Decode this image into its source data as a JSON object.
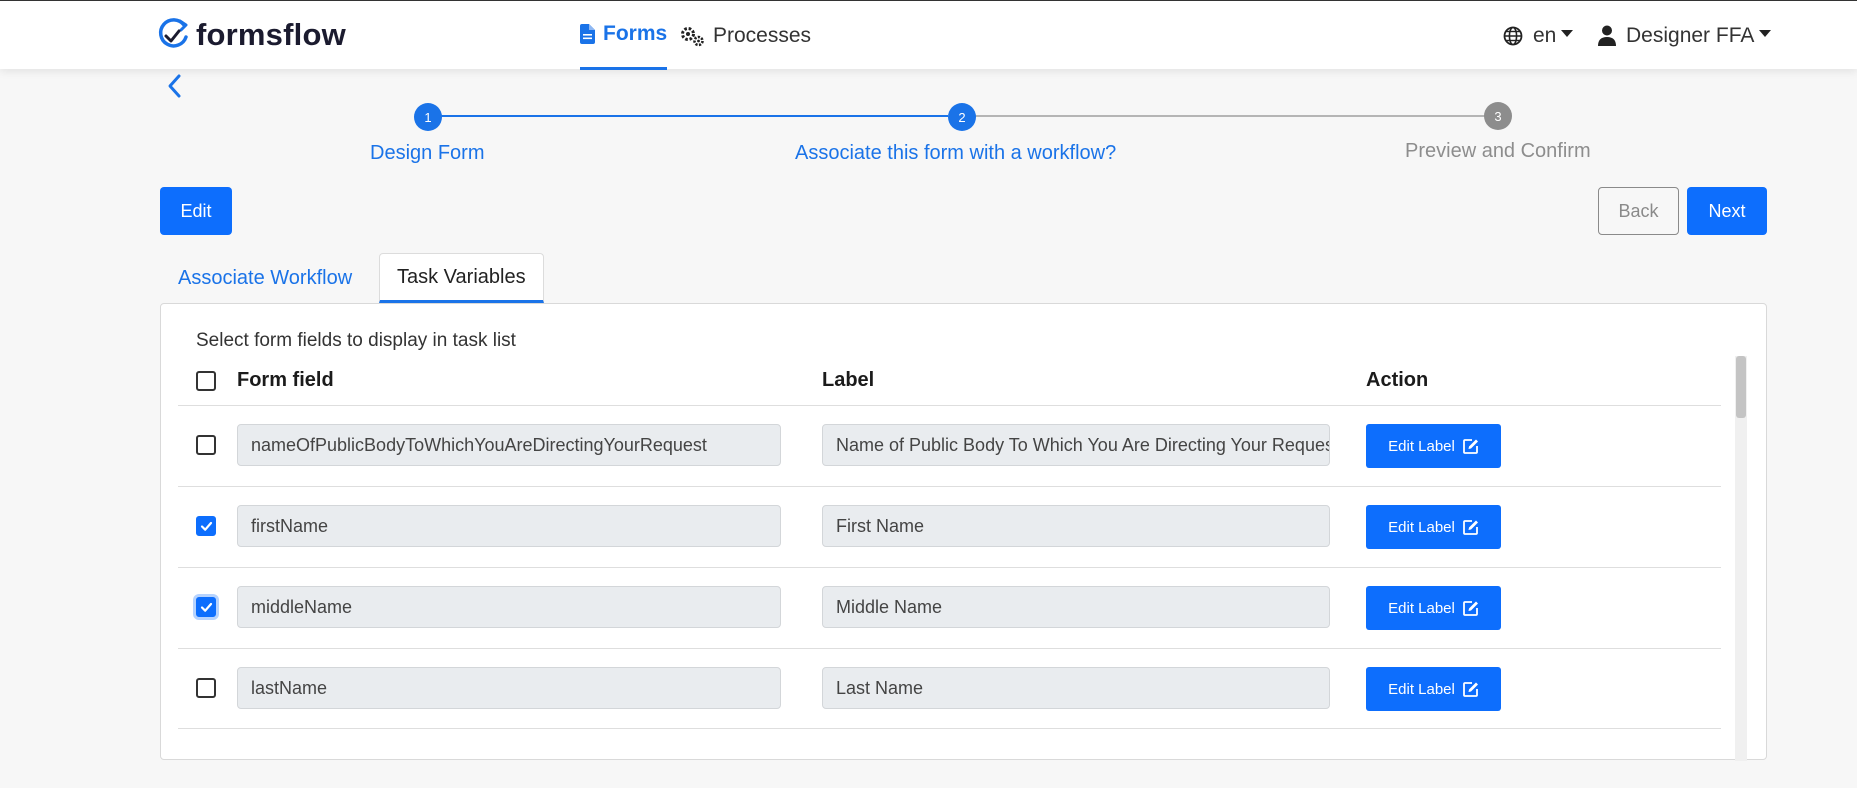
{
  "brand": {
    "name": "formsflow",
    "logo": "formsflow-refresh-check-logo"
  },
  "nav": {
    "forms": {
      "label": "Forms",
      "icon": "file-icon"
    },
    "processes": {
      "label": "Processes",
      "icon": "gears-icon"
    },
    "language": {
      "label": "en",
      "icon": "globe-icon"
    },
    "user": {
      "label": "Designer FFA",
      "icon": "user-icon"
    }
  },
  "stepper": {
    "steps": [
      {
        "number": "1",
        "label": "Design Form",
        "state": "complete"
      },
      {
        "number": "2",
        "label": "Associate this form with a workflow?",
        "state": "active"
      },
      {
        "number": "3",
        "label": "Preview and Confirm",
        "state": "pending"
      }
    ]
  },
  "actions": {
    "edit": "Edit",
    "back": "Back",
    "next": "Next"
  },
  "tabs": [
    {
      "label": "Associate Workflow",
      "active": false
    },
    {
      "label": "Task Variables",
      "active": true
    }
  ],
  "task_variables": {
    "caption": "Select form fields to display in task list",
    "columns": [
      "Form field",
      "Label",
      "Action"
    ],
    "rows": [
      {
        "field": "nameOfPublicBodyToWhichYouAreDirectingYourRequest",
        "label": "Name of Public Body To Which You Are Directing Your Request",
        "checked": false,
        "action": "Edit Label"
      },
      {
        "field": "firstName",
        "label": "First Name",
        "checked": true,
        "action": "Edit Label"
      },
      {
        "field": "middleName",
        "label": "Middle Name",
        "checked": true,
        "action": "Edit Label"
      },
      {
        "field": "lastName",
        "label": "Last Name",
        "checked": false,
        "action": "Edit Label"
      }
    ]
  },
  "colors": {
    "primary": "#0d6efd",
    "link": "#1a73e8",
    "muted": "#8d8d8d",
    "background": "#f7f7f7"
  }
}
